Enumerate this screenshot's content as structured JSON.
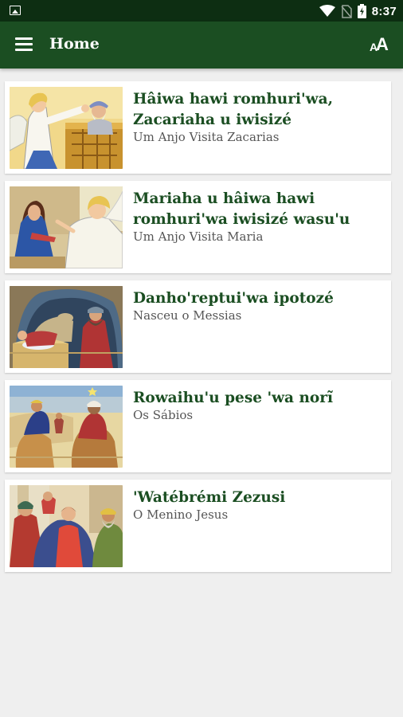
{
  "status_bar": {
    "time": "8:37",
    "icons": [
      "gallery-icon",
      "wifi-icon",
      "no-sim-icon",
      "battery-icon"
    ]
  },
  "app_bar": {
    "title": "Home",
    "menu_icon": "menu-icon",
    "font_size_icon": "font-size-icon",
    "background": "#1b4e22"
  },
  "stories": [
    {
      "title": "Hâiwa hawi romhuri'wa, Zacariaha u iwisizé",
      "subtitle": "Um Anjo Visita Zacarias",
      "image": "angel-visits-zacharias"
    },
    {
      "title": "Mariaha u hâiwa hawi romhuri'wa iwisizé wasu'u",
      "subtitle": "Um Anjo Visita Maria",
      "image": "angel-visits-mary"
    },
    {
      "title": "Danho'reptui'wa ipotozé",
      "subtitle": "Nasceu o Messias",
      "image": "messiah-born"
    },
    {
      "title": "Rowaihu'u pese 'wa norĩ",
      "subtitle": "Os Sábios",
      "image": "wise-men"
    },
    {
      "title": "'Watébrémi Zezusi",
      "subtitle": "O Menino Jesus",
      "image": "boy-jesus"
    }
  ]
}
